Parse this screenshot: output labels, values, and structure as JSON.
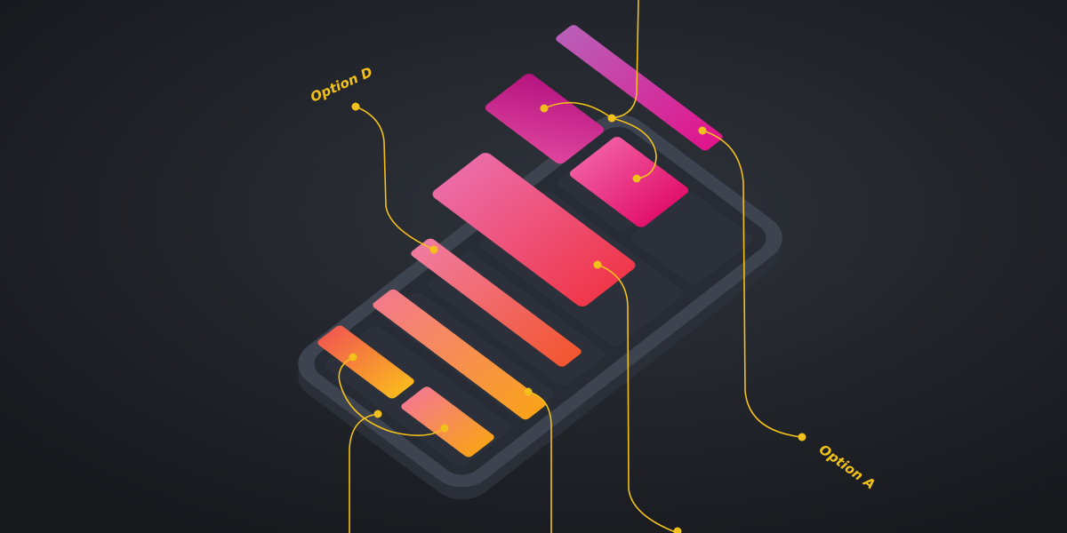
{
  "labels": {
    "option_d": "Option D",
    "option_a": "Option A"
  },
  "colors": {
    "background": "#202328",
    "phone_body": "#3a404b",
    "phone_screen": "#262b34",
    "connector": "#f2c01b",
    "tile_pink": "#e6157a",
    "tile_magenta": "#c4148c",
    "tile_orange": "#f7a21c",
    "tile_red": "#f0433d"
  },
  "icons": [
    "isometric-phone-illustration"
  ]
}
